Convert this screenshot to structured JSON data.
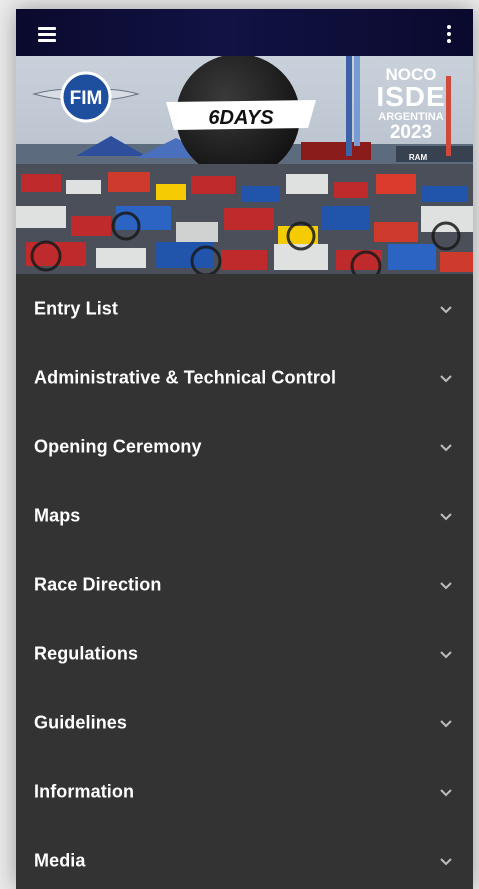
{
  "app_bar": {
    "menu_icon": "hamburger-menu-icon",
    "more_icon": "more-vert-icon"
  },
  "banner": {
    "fim_logo_text": "FIM",
    "sixdays_text": "6DAYS",
    "noco_text": "NOCO",
    "isde_text": "ISDE",
    "country_text": "ARGENTINA",
    "year_text": "2023",
    "ram_text": "RAM"
  },
  "accordion": {
    "chevron_icon": "chevron-down-icon",
    "items": [
      {
        "label": "Entry List"
      },
      {
        "label": "Administrative & Technical Control"
      },
      {
        "label": "Opening Ceremony"
      },
      {
        "label": "Maps"
      },
      {
        "label": "Race Direction"
      },
      {
        "label": "Regulations"
      },
      {
        "label": "Guidelines"
      },
      {
        "label": "Information"
      },
      {
        "label": "Media"
      }
    ]
  },
  "colors": {
    "app_bar": "#0a0a2e",
    "background": "#333333",
    "text": "#ffffff",
    "chevron": "#bdbdbd"
  }
}
